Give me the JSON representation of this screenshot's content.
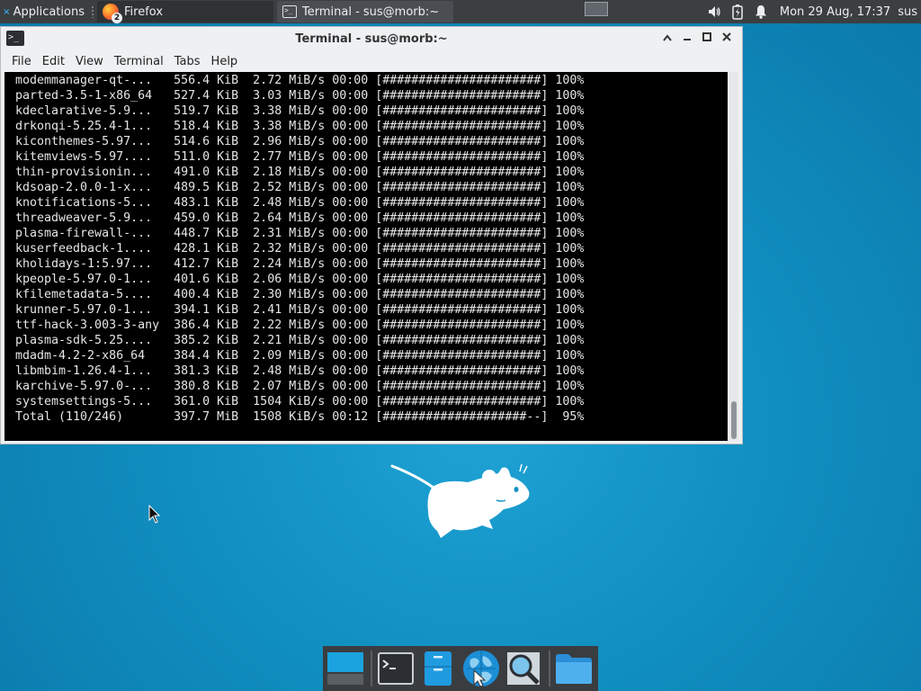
{
  "panel": {
    "applications_label": "Applications",
    "tasks": [
      {
        "label": "Firefox",
        "badge": "2"
      },
      {
        "label": "Terminal - sus@morb:~"
      }
    ],
    "clock": "Mon 29 Aug, 17:37",
    "user": "sus"
  },
  "window": {
    "title": "Terminal - sus@morb:~",
    "prompt_icon": ">_",
    "menu": [
      "File",
      "Edit",
      "View",
      "Terminal",
      "Tabs",
      "Help"
    ],
    "lines": [
      "modemmanager-qt-...   556.4 KiB  2.72 MiB/s 00:00 [######################] 100%",
      "parted-3.5-1-x86_64   527.4 KiB  3.03 MiB/s 00:00 [######################] 100%",
      "kdeclarative-5.9...   519.7 KiB  3.38 MiB/s 00:00 [######################] 100%",
      "drkonqi-5.25.4-1...   518.4 KiB  3.38 MiB/s 00:00 [######################] 100%",
      "kiconthemes-5.97...   514.6 KiB  2.96 MiB/s 00:00 [######################] 100%",
      "kitemviews-5.97....   511.0 KiB  2.77 MiB/s 00:00 [######################] 100%",
      "thin-provisionin...   491.0 KiB  2.18 MiB/s 00:00 [######################] 100%",
      "kdsoap-2.0.0-1-x...   489.5 KiB  2.52 MiB/s 00:00 [######################] 100%",
      "knotifications-5...   483.1 KiB  2.48 MiB/s 00:00 [######################] 100%",
      "threadweaver-5.9...   459.0 KiB  2.64 MiB/s 00:00 [######################] 100%",
      "plasma-firewall-...   448.7 KiB  2.31 MiB/s 00:00 [######################] 100%",
      "kuserfeedback-1....   428.1 KiB  2.32 MiB/s 00:00 [######################] 100%",
      "kholidays-1:5.97...   412.7 KiB  2.24 MiB/s 00:00 [######################] 100%",
      "kpeople-5.97.0-1...   401.6 KiB  2.06 MiB/s 00:00 [######################] 100%",
      "kfilemetadata-5....   400.4 KiB  2.30 MiB/s 00:00 [######################] 100%",
      "krunner-5.97.0-1...   394.1 KiB  2.41 MiB/s 00:00 [######################] 100%",
      "ttf-hack-3.003-3-any  386.4 KiB  2.22 MiB/s 00:00 [######################] 100%",
      "plasma-sdk-5.25....   385.2 KiB  2.21 MiB/s 00:00 [######################] 100%",
      "mdadm-4.2-2-x86_64    384.4 KiB  2.09 MiB/s 00:00 [######################] 100%",
      "libmbim-1.26.4-1...   381.3 KiB  2.48 MiB/s 00:00 [######################] 100%",
      "karchive-5.97.0-...   380.8 KiB  2.07 MiB/s 00:00 [######################] 100%",
      "systemsettings-5...   361.0 KiB  1504 KiB/s 00:00 [######################] 100%",
      "Total (110/246)       397.7 MiB  1508 KiB/s 00:12 [####################--]  95%"
    ]
  },
  "colors": {
    "desktop": "#1190c2",
    "panel": "#3b3f42",
    "terminal_bg": "#000000",
    "terminal_fg": "#e6e6e6"
  },
  "icons": {
    "panel_apps": "xfce-mouse-icon",
    "tray": [
      "volume-icon",
      "battery-icon",
      "notification-bell-icon"
    ],
    "dock": [
      "show-desktop-icon",
      "terminal-icon",
      "file-manager-icon",
      "web-browser-icon",
      "app-finder-icon",
      "folder-icon"
    ]
  }
}
